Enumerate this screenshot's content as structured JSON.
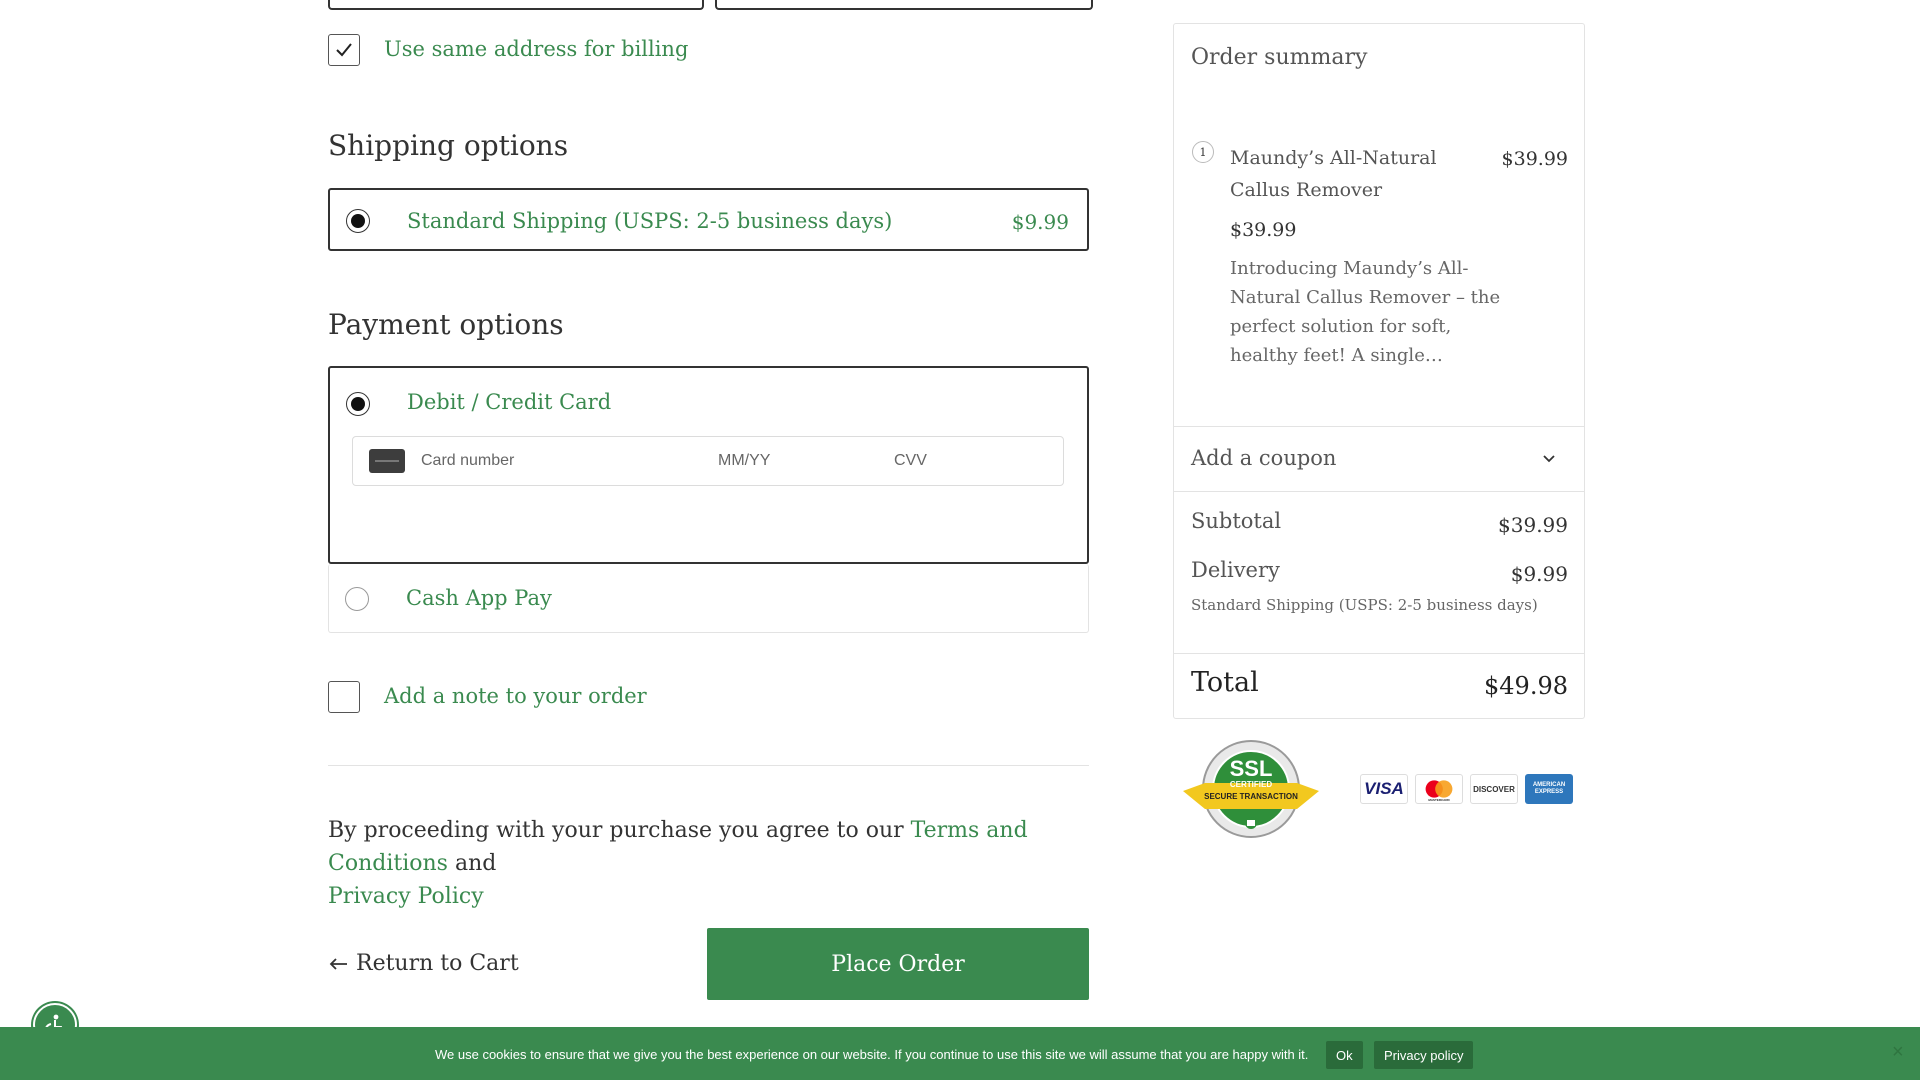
{
  "billing": {
    "same_address_label": "Use same address for billing",
    "same_address_checked": true
  },
  "shipping": {
    "title": "Shipping options",
    "options": [
      {
        "label": "Standard Shipping (USPS: 2-5 business days)",
        "price": "$9.99",
        "selected": true
      }
    ]
  },
  "payment": {
    "title": "Payment options",
    "options": [
      {
        "label": "Debit / Credit Card",
        "selected": true
      },
      {
        "label": "Cash App Pay",
        "selected": false
      }
    ],
    "card_number_placeholder": "Card number",
    "expiry_placeholder": "MM/YY",
    "cvv_placeholder": "CVV"
  },
  "note": {
    "label": "Add a note to your order",
    "checked": false
  },
  "terms": {
    "prefix": "By proceeding with your purchase you agree to our ",
    "terms_link": "Terms and Conditions",
    "and": " and",
    "privacy_link": "Privacy Policy"
  },
  "actions": {
    "return_label": "Return to Cart",
    "place_order_label": "Place Order"
  },
  "summary": {
    "title": "Order summary",
    "item": {
      "quantity": "1",
      "name": "Maundy’s All-Natural Callus Remover",
      "price": "$39.99",
      "unit_price": "$39.99",
      "description": "Introducing Maundy’s All-Natural Callus Remover – the perfect solution for soft, healthy feet! A single…"
    },
    "coupon_label": "Add a coupon",
    "subtotal_label": "Subtotal",
    "subtotal_value": "$39.99",
    "delivery_label": "Delivery",
    "delivery_value": "$9.99",
    "delivery_method": "Standard Shipping (USPS: 2-5 business days)",
    "total_label": "Total",
    "total_value": "$49.98"
  },
  "trust": {
    "ssl_title": "SSL",
    "ssl_sub": "CERTIFIED",
    "ssl_ribbon": "SECURE TRANSACTION",
    "cards": [
      "VISA",
      "MASTERCARD",
      "DISCOVER",
      "AMERICAN EXPRESS"
    ]
  },
  "cookie": {
    "message": "We use cookies to ensure that we give you the best experience on our website. If you continue to use this site we will assume that you are happy with it.",
    "ok_label": "Ok",
    "privacy_label": "Privacy policy",
    "close_label": "×"
  },
  "colors": {
    "brand_green": "#3a8a4f",
    "text": "#333333",
    "border": "#e3e3e3"
  }
}
